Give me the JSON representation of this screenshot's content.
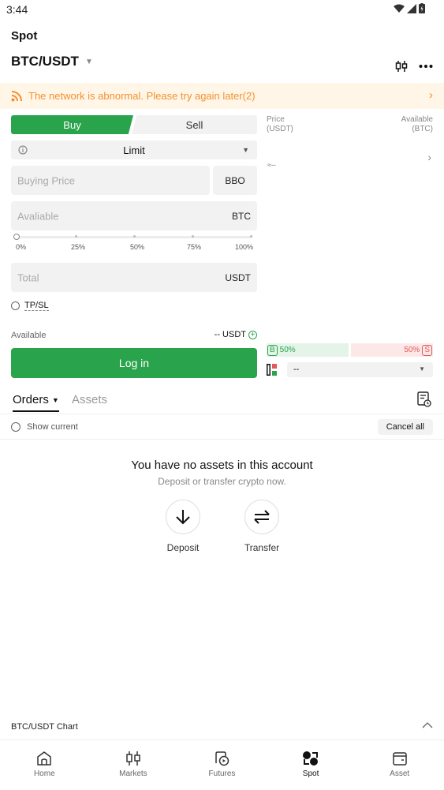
{
  "status": {
    "time": "3:44"
  },
  "header": {
    "title": "Spot",
    "pair": "BTC/USDT"
  },
  "alert": {
    "text": "The network is abnormal. Please try again later(2)"
  },
  "trade": {
    "buy_label": "Buy",
    "sell_label": "Sell",
    "order_type": "Limit",
    "price_placeholder": "Buying Price",
    "bbo_label": "BBO",
    "amount_placeholder": "Avaliable",
    "amount_unit": "BTC",
    "slider_labels": [
      "0%",
      "25%",
      "50%",
      "75%",
      "100%"
    ],
    "slider_value": 0,
    "total_placeholder": "Total",
    "total_unit": "USDT",
    "tpsl_label": "TP/SL",
    "available_label": "Available",
    "available_value": "-- USDT",
    "login_label": "Log in"
  },
  "orderbook": {
    "price_header": "Price",
    "price_unit": "(USDT)",
    "available_header": "Available",
    "available_unit": "(BTC)",
    "mid_price": "≈--",
    "buy_ratio": "50%",
    "sell_ratio": "50%",
    "buy_badge": "B",
    "sell_badge": "S",
    "depth_value": "--"
  },
  "tabs": {
    "orders": "Orders",
    "assets": "Assets"
  },
  "filter": {
    "show_current": "Show current",
    "cancel_all": "Cancel all"
  },
  "empty": {
    "title": "You have no assets in this account",
    "subtitle": "Deposit or transfer crypto now.",
    "deposit": "Deposit",
    "transfer": "Transfer"
  },
  "chart_bar": {
    "label": "BTC/USDT Chart"
  },
  "nav": {
    "home": "Home",
    "markets": "Markets",
    "futures": "Futures",
    "spot": "Spot",
    "asset": "Asset"
  },
  "colors": {
    "green": "#2aa44c",
    "red": "#e45858",
    "warning": "#f5902f"
  }
}
